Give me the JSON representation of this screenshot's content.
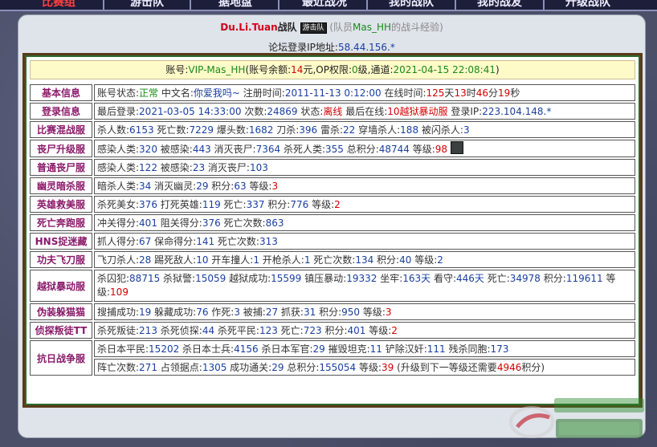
{
  "nav": {
    "tabs": [
      "比赛组",
      "游击队",
      "据地盘",
      "最近战况",
      "我的战队",
      "我的战友",
      "升级战队"
    ]
  },
  "header": {
    "team_name": "Du.Li.Tuan",
    "team_suffix": "战队",
    "badge": "游击队",
    "sub_prefix": "(队员",
    "member": "Mas_HH",
    "sub_suffix": "的战斗经验)"
  },
  "ip": {
    "label": "论坛登录IP地址:",
    "value": "58.44.156.*"
  },
  "account": {
    "label": "账号:",
    "name": "VIP-Mas_HH",
    "balance_label": "(账号余额:",
    "balance": "14",
    "balance_unit": "元,",
    "op_label": "OP权限:",
    "op": "0",
    "op_unit": "级,",
    "channel_label": "通道:",
    "channel_time": "2021-04-15 22:08:41",
    "close": ")"
  },
  "rows": [
    {
      "label": "基本信息",
      "segs": [
        {
          "t": "账号状态:"
        },
        {
          "t": "正常",
          "c": "g"
        },
        {
          "t": " 中文名:"
        },
        {
          "t": "你爱我吗~",
          "c": "v"
        },
        {
          "t": " 注册时间:"
        },
        {
          "t": "2011-11-13 0:12:00",
          "c": "v"
        },
        {
          "t": " 在线时间:"
        },
        {
          "t": "125",
          "c": "r"
        },
        {
          "t": "天"
        },
        {
          "t": "13",
          "c": "r"
        },
        {
          "t": "时"
        },
        {
          "t": "46",
          "c": "r"
        },
        {
          "t": "分"
        },
        {
          "t": "19",
          "c": "r"
        },
        {
          "t": "秒"
        }
      ]
    },
    {
      "label": "登录信息",
      "segs": [
        {
          "t": "最后登录:"
        },
        {
          "t": "2021-03-05 14:33:00",
          "c": "v"
        },
        {
          "t": " 次数:"
        },
        {
          "t": "24869",
          "c": "v"
        },
        {
          "t": " 状态:"
        },
        {
          "t": "离线",
          "c": "r"
        },
        {
          "t": " 最后在线:"
        },
        {
          "t": "10越狱暴动服",
          "c": "r"
        },
        {
          "t": " 登录IP:"
        },
        {
          "t": "223.104.148.*",
          "c": "v"
        }
      ]
    },
    {
      "label": "比赛混战服",
      "segs": [
        {
          "t": "杀人数:"
        },
        {
          "t": "6153",
          "c": "v"
        },
        {
          "t": " 死亡数:"
        },
        {
          "t": "7229",
          "c": "v"
        },
        {
          "t": " 爆头数:"
        },
        {
          "t": "1682",
          "c": "v"
        },
        {
          "t": " 刀杀:"
        },
        {
          "t": "396",
          "c": "v"
        },
        {
          "t": " 雷杀:"
        },
        {
          "t": "22",
          "c": "v"
        },
        {
          "t": " 穿墙杀人:"
        },
        {
          "t": "188",
          "c": "v"
        },
        {
          "t": " 被闪杀人:"
        },
        {
          "t": "3",
          "c": "v"
        }
      ]
    },
    {
      "label": "丧尸升级服",
      "avatar": true,
      "segs": [
        {
          "t": "感染人类:"
        },
        {
          "t": "320",
          "c": "v"
        },
        {
          "t": " 被感染:"
        },
        {
          "t": "443",
          "c": "v"
        },
        {
          "t": " 消灭丧尸:"
        },
        {
          "t": "7364",
          "c": "v"
        },
        {
          "t": " 杀死人类:"
        },
        {
          "t": "355",
          "c": "v"
        },
        {
          "t": " 总积分:"
        },
        {
          "t": "48744",
          "c": "v"
        },
        {
          "t": " 等级:"
        },
        {
          "t": "98",
          "c": "r"
        }
      ]
    },
    {
      "label": "普通丧尸服",
      "segs": [
        {
          "t": "感染人类:"
        },
        {
          "t": "122",
          "c": "v"
        },
        {
          "t": " 被感染:"
        },
        {
          "t": "23",
          "c": "v"
        },
        {
          "t": " 消灭丧尸:"
        },
        {
          "t": "103",
          "c": "v"
        }
      ]
    },
    {
      "label": "幽灵暗杀服",
      "segs": [
        {
          "t": "暗杀人类:"
        },
        {
          "t": "34",
          "c": "v"
        },
        {
          "t": " 消灭幽灵:"
        },
        {
          "t": "29",
          "c": "v"
        },
        {
          "t": " 积分:"
        },
        {
          "t": "63",
          "c": "v"
        },
        {
          "t": " 等级:"
        },
        {
          "t": "3",
          "c": "r"
        }
      ]
    },
    {
      "label": "英雄救美服",
      "segs": [
        {
          "t": "杀死美女:"
        },
        {
          "t": "376",
          "c": "v"
        },
        {
          "t": " 打死英雄:"
        },
        {
          "t": "119",
          "c": "v"
        },
        {
          "t": " 死亡:"
        },
        {
          "t": "337",
          "c": "v"
        },
        {
          "t": " 积分:"
        },
        {
          "t": "776",
          "c": "v"
        },
        {
          "t": " 等级:"
        },
        {
          "t": "2",
          "c": "r"
        }
      ]
    },
    {
      "label": "死亡奔跑服",
      "segs": [
        {
          "t": "冲关得分:"
        },
        {
          "t": "401",
          "c": "v"
        },
        {
          "t": " 阻关得分:"
        },
        {
          "t": "376",
          "c": "v"
        },
        {
          "t": " 死亡次数:"
        },
        {
          "t": "863",
          "c": "v"
        }
      ]
    },
    {
      "label": "HNS捉迷藏",
      "segs": [
        {
          "t": "抓人得分:"
        },
        {
          "t": "67",
          "c": "v"
        },
        {
          "t": " 保命得分:"
        },
        {
          "t": "141",
          "c": "v"
        },
        {
          "t": " 死亡次数:"
        },
        {
          "t": "313",
          "c": "v"
        }
      ]
    },
    {
      "label": "功夫飞刀服",
      "segs": [
        {
          "t": "飞刀杀人:"
        },
        {
          "t": "28",
          "c": "v"
        },
        {
          "t": " 踢死敌人:"
        },
        {
          "t": "10",
          "c": "v"
        },
        {
          "t": " 开车撞人:"
        },
        {
          "t": "1",
          "c": "v"
        },
        {
          "t": " 开枪杀人:"
        },
        {
          "t": "1",
          "c": "v"
        },
        {
          "t": " 死亡次数:"
        },
        {
          "t": "134",
          "c": "v"
        },
        {
          "t": " 积分:"
        },
        {
          "t": "40",
          "c": "v"
        },
        {
          "t": " 等级:"
        },
        {
          "t": "2",
          "c": "v"
        }
      ]
    },
    {
      "label": "越狱暴动服",
      "wrap": true,
      "segs": [
        {
          "t": "杀囚犯:"
        },
        {
          "t": "88715",
          "c": "v"
        },
        {
          "t": " 杀狱警:"
        },
        {
          "t": "15059",
          "c": "v"
        },
        {
          "t": " 越狱成功:"
        },
        {
          "t": "15599",
          "c": "v"
        },
        {
          "t": " 镇压暴动:"
        },
        {
          "t": "19332",
          "c": "v"
        },
        {
          "t": " 坐牢:"
        },
        {
          "t": "163天",
          "c": "v"
        },
        {
          "t": " 看守:"
        },
        {
          "t": "446天",
          "c": "v"
        },
        {
          "t": " 死亡:"
        },
        {
          "t": "34978",
          "c": "v"
        },
        {
          "t": " 积分:"
        },
        {
          "t": "119611",
          "c": "v"
        },
        {
          "t": " 等级:"
        },
        {
          "t": "109",
          "c": "r"
        }
      ]
    },
    {
      "label": "伪装躲猫猫",
      "segs": [
        {
          "t": "搜捕成功:"
        },
        {
          "t": "19",
          "c": "v"
        },
        {
          "t": " 躲藏成功:"
        },
        {
          "t": "76",
          "c": "v"
        },
        {
          "t": " 作死:"
        },
        {
          "t": "3",
          "c": "v"
        },
        {
          "t": " 被捕:"
        },
        {
          "t": "27",
          "c": "v"
        },
        {
          "t": " 抓获:"
        },
        {
          "t": "31",
          "c": "v"
        },
        {
          "t": " 积分:"
        },
        {
          "t": "950",
          "c": "v"
        },
        {
          "t": " 等级:"
        },
        {
          "t": "3",
          "c": "r"
        }
      ]
    },
    {
      "label": "侦探叛徒TT",
      "segs": [
        {
          "t": "杀死叛徒:"
        },
        {
          "t": "213",
          "c": "v"
        },
        {
          "t": " 杀死侦探:"
        },
        {
          "t": "44",
          "c": "v"
        },
        {
          "t": " 杀死平民:"
        },
        {
          "t": "123",
          "c": "v"
        },
        {
          "t": " 死亡:"
        },
        {
          "t": "723",
          "c": "v"
        },
        {
          "t": " 积分:"
        },
        {
          "t": "401",
          "c": "v"
        },
        {
          "t": " 等级:"
        },
        {
          "t": "2",
          "c": "r"
        }
      ]
    }
  ],
  "war": {
    "label": "抗日战争服",
    "line1": [
      {
        "t": "杀日本平民:"
      },
      {
        "t": "15202",
        "c": "v"
      },
      {
        "t": " 杀日本士兵:"
      },
      {
        "t": "4156",
        "c": "v"
      },
      {
        "t": " 杀日本军官:"
      },
      {
        "t": "29",
        "c": "v"
      },
      {
        "t": " 摧毁坦克:"
      },
      {
        "t": "11",
        "c": "v"
      },
      {
        "t": " 铲除汉奸:"
      },
      {
        "t": "111",
        "c": "v"
      },
      {
        "t": " 残杀同胞:"
      },
      {
        "t": "173",
        "c": "v"
      }
    ],
    "line2": [
      {
        "t": "阵亡次数:"
      },
      {
        "t": "271",
        "c": "v"
      },
      {
        "t": " 占领据点:"
      },
      {
        "t": "1305",
        "c": "v"
      },
      {
        "t": " 成功通关:"
      },
      {
        "t": "29",
        "c": "v"
      },
      {
        "t": " 总积分:"
      },
      {
        "t": "155054",
        "c": "v"
      },
      {
        "t": " 等级:"
      },
      {
        "t": "39",
        "c": "r"
      },
      {
        "t": " (升级到下一等级还需要"
      },
      {
        "t": "4946",
        "c": "r"
      },
      {
        "t": "积分)"
      }
    ]
  },
  "colors": {
    "label": "#8a1a6a",
    "value": "#1a3fa0",
    "alert": "#d40000",
    "ok": "#1a8a1a",
    "account_bg": "#fffbc8"
  }
}
